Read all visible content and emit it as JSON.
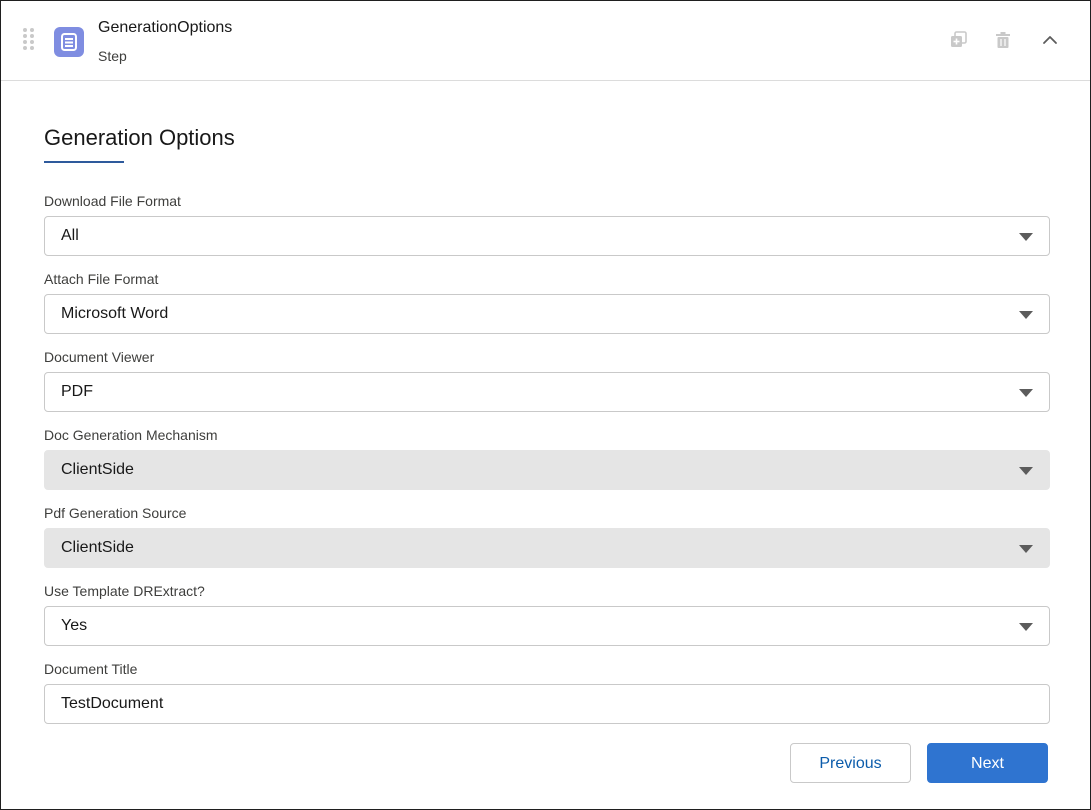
{
  "header": {
    "title": "GenerationOptions",
    "subtitle": "Step",
    "icons": {
      "drag": "drag-handle-icon",
      "step": "document-list-icon",
      "copy": "copy-icon",
      "delete": "trash-icon",
      "collapse": "chevron-up-icon"
    }
  },
  "card": {
    "title": "Generation Options",
    "accent_color": "#2e5a9c"
  },
  "fields": {
    "download_file_format": {
      "label": "Download File Format",
      "value": "All"
    },
    "attach_file_format": {
      "label": "Attach File Format",
      "value": "Microsoft Word"
    },
    "document_viewer": {
      "label": "Document Viewer",
      "value": "PDF"
    },
    "doc_generation_mechanism": {
      "label": "Doc Generation Mechanism",
      "value": "ClientSide",
      "disabled": true
    },
    "pdf_generation_source": {
      "label": "Pdf Generation Source",
      "value": "ClientSide",
      "disabled": true
    },
    "use_template_drextract": {
      "label": "Use Template DRExtract?",
      "value": "Yes"
    },
    "document_title": {
      "label": "Document Title",
      "value": "TestDocument"
    }
  },
  "footer": {
    "previous_label": "Previous",
    "next_label": "Next",
    "primary_color": "#2f74d0"
  }
}
